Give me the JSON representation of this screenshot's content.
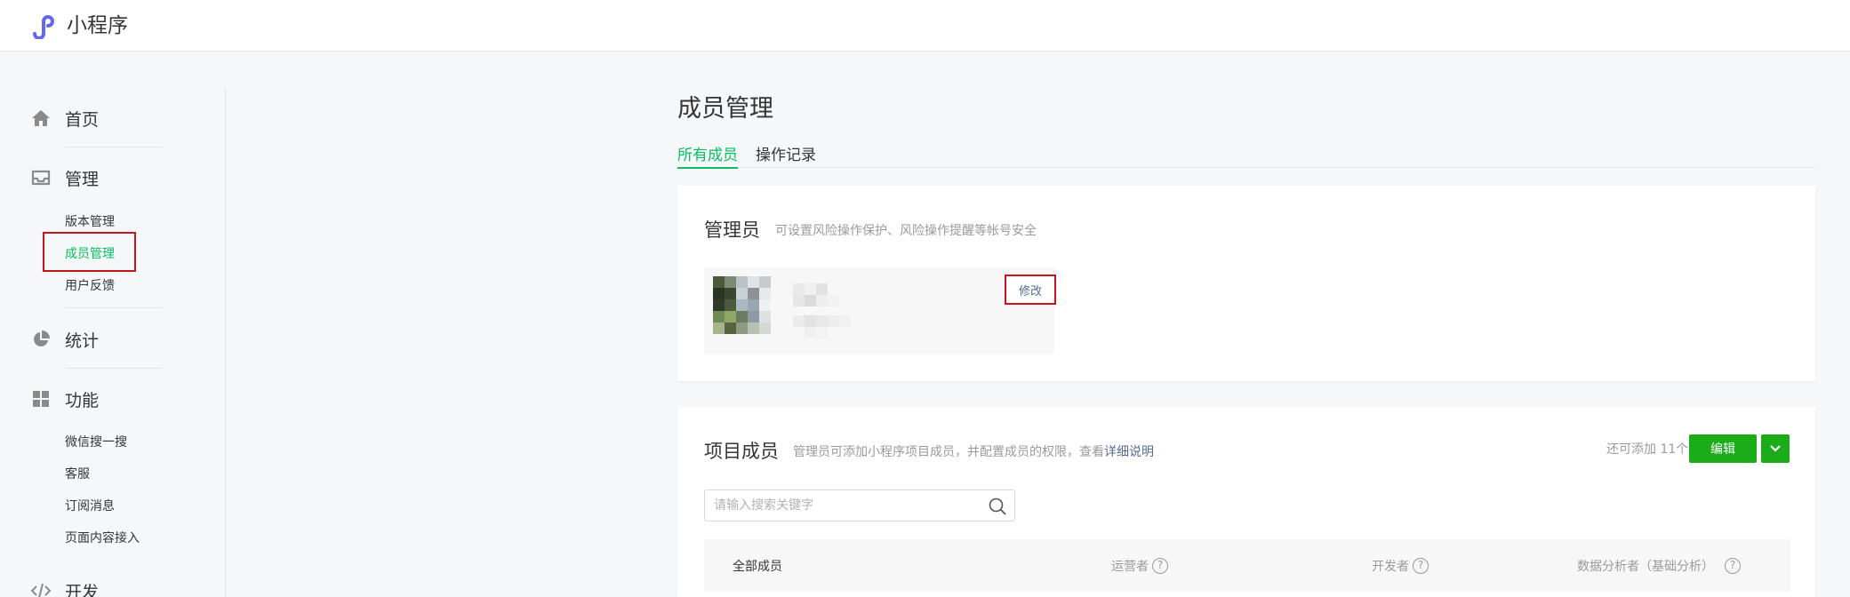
{
  "app": {
    "name": "小程序"
  },
  "sidebar": {
    "home": "首页",
    "manage": "管理",
    "manage_items": [
      "版本管理",
      "成员管理",
      "用户反馈"
    ],
    "stats": "统计",
    "features": "功能",
    "feature_items": [
      "微信搜一搜",
      "客服",
      "订阅消息",
      "页面内容接入"
    ],
    "dev": "开发"
  },
  "page": {
    "title": "成员管理",
    "tabs": [
      {
        "label": "所有成员",
        "active": true
      },
      {
        "label": "操作记录",
        "active": false
      }
    ]
  },
  "admin_card": {
    "title": "管理员",
    "desc": "可设置风险操作保护、风险操作提醒等帐号安全",
    "edit_label": "修改"
  },
  "members_card": {
    "title": "项目成员",
    "desc": "管理员可添加小程序项目成员，并配置成员的权限，查看",
    "desc_link": "详细说明",
    "remaining": "还可添加 11个",
    "edit_button": "编辑",
    "search_placeholder": "请输入搜索关键字",
    "columns": [
      "全部成员",
      "运营者",
      "开发者",
      "数据分析者（基础分析）"
    ]
  },
  "colors": {
    "accent": "#07c160",
    "button": "#1aad19",
    "highlight": "#c4161c",
    "link": "#576b95"
  }
}
